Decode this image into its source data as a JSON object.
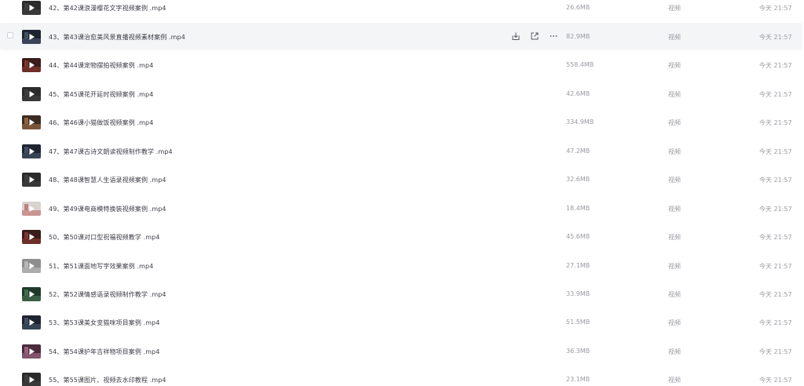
{
  "files": [
    {
      "name": "42、第42课浪漫樱花文字视频案例 .mp4",
      "size": "26.6MB",
      "type": "视频",
      "time": "今天 21:57",
      "thumb": "dark-gray",
      "hovered": false
    },
    {
      "name": "43、第43课治愈美风景直播视频素材案例 .mp4",
      "size": "82.9MB",
      "type": "视频",
      "time": "今天 21:57",
      "thumb": "dark-scene",
      "hovered": true
    },
    {
      "name": "44、第44课宠物摆拍视频案例 .mp4",
      "size": "558.4MB",
      "type": "视频",
      "time": "今天 21:57",
      "thumb": "red-scene",
      "hovered": false
    },
    {
      "name": "45、第45课花开延时视频案例 .mp4",
      "size": "42.6MB",
      "type": "视频",
      "time": "今天 21:57",
      "thumb": "dark-gray",
      "hovered": false
    },
    {
      "name": "46、第46课小猫做饭视频案例 .mp4",
      "size": "334.9MB",
      "type": "视频",
      "time": "今天 21:57",
      "thumb": "cat-scene",
      "hovered": false
    },
    {
      "name": "47、第47课古诗文朗读视频制作教学 .mp4",
      "size": "47.2MB",
      "type": "视频",
      "time": "今天 21:57",
      "thumb": "dark-scene",
      "hovered": false
    },
    {
      "name": "48、第48课智慧人生语录视频案例 .mp4",
      "size": "32.6MB",
      "type": "视频",
      "time": "今天 21:57",
      "thumb": "dark-gray",
      "hovered": false
    },
    {
      "name": "49、第49课电商模特换装视频案例 .mp4",
      "size": "18.4MB",
      "type": "视频",
      "time": "今天 21:57",
      "thumb": "light-scene",
      "hovered": false
    },
    {
      "name": "50、第50课对口型祝福视频教学 .mp4",
      "size": "45.6MB",
      "type": "视频",
      "time": "今天 21:57",
      "thumb": "red-scene",
      "hovered": false
    },
    {
      "name": "51、第51课面地写字效果案例 .mp4",
      "size": "27.1MB",
      "type": "视频",
      "time": "今天 21:57",
      "thumb": "gray-scene",
      "hovered": false
    },
    {
      "name": "52、第52课情感语录视频制作教学 .mp4",
      "size": "33.9MB",
      "type": "视频",
      "time": "今天 21:57",
      "thumb": "green-scene",
      "hovered": false
    },
    {
      "name": "53、第53课美女变猫咪项目案例 .mp4",
      "size": "51.5MB",
      "type": "视频",
      "time": "今天 21:57",
      "thumb": "dark-scene",
      "hovered": false
    },
    {
      "name": "54、第54课护年吉祥物项目案例 .mp4",
      "size": "36.3MB",
      "type": "视频",
      "time": "今天 21:57",
      "thumb": "pink-scene",
      "hovered": false
    },
    {
      "name": "55、第55课图片、视频去水印教程 .mp4",
      "size": "23.1MB",
      "type": "视频",
      "time": "今天 21:57",
      "thumb": "dark-gray",
      "hovered": false
    }
  ],
  "row_actions": [
    "download-icon",
    "share-icon",
    "more-icon"
  ]
}
